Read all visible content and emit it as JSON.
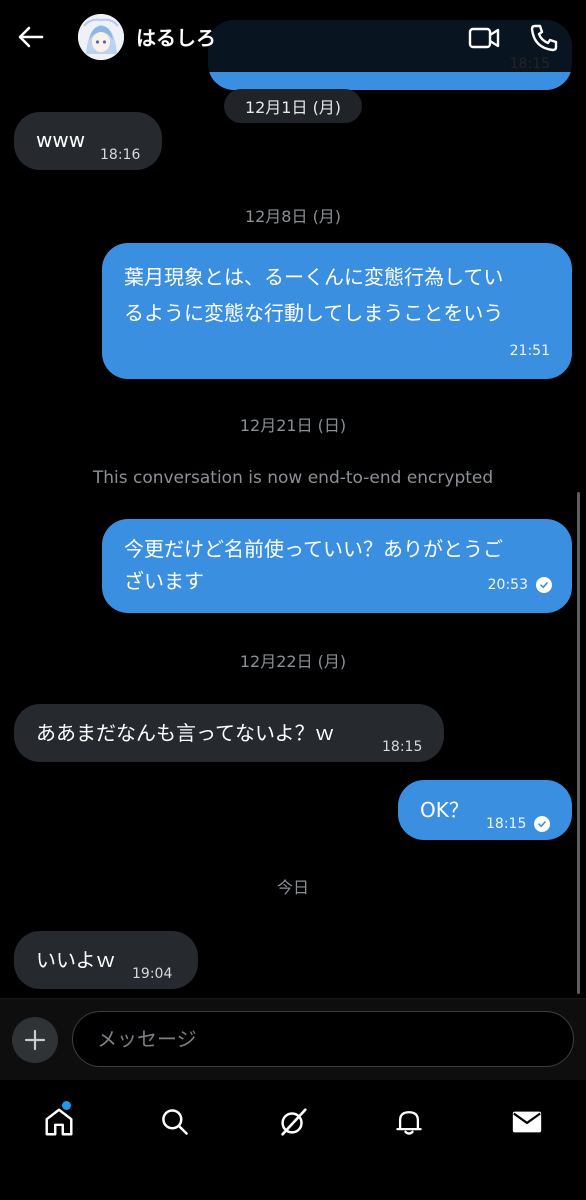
{
  "header": {
    "title": "はるしろ",
    "icons": [
      "back-arrow-icon",
      "video-call-icon",
      "phone-icon"
    ]
  },
  "messages": {
    "dates": {
      "d1": "12月1日 (月)",
      "d2": "12月8日 (月)",
      "d3": "12月21日 (日)",
      "d4": "12月22日 (月)",
      "d5": "今日"
    },
    "system": "This conversation is now end-to-end encrypted",
    "m1": {
      "text": "www",
      "time": "18:16"
    },
    "m2": {
      "text": "葉月現象とは、るーくんに変態行為してい\nるように変態な行動してしまうことをいう",
      "time": "21:51"
    },
    "m3": {
      "text": "今更だけど名前使っていい？ありがとうご\nざいます",
      "time": "20:53"
    },
    "m4": {
      "text": "ああまだなんも言ってないよ？ｗ",
      "time": "18:15"
    },
    "m5": {
      "text": "OK？",
      "time": "18:15"
    },
    "m6": {
      "text": "いいよｗ",
      "time": "19:04"
    },
    "partial_time": "18:15"
  },
  "composer": {
    "placeholder": "メッセージ"
  },
  "tabbar": {
    "items": [
      "home-icon",
      "search-icon",
      "grok-icon",
      "notifications-icon",
      "messages-icon"
    ]
  },
  "colors": {
    "outgoing_bubble": "#3b8fe0",
    "incoming_bubble": "#262a2e",
    "accent": "#1d9bf0"
  }
}
